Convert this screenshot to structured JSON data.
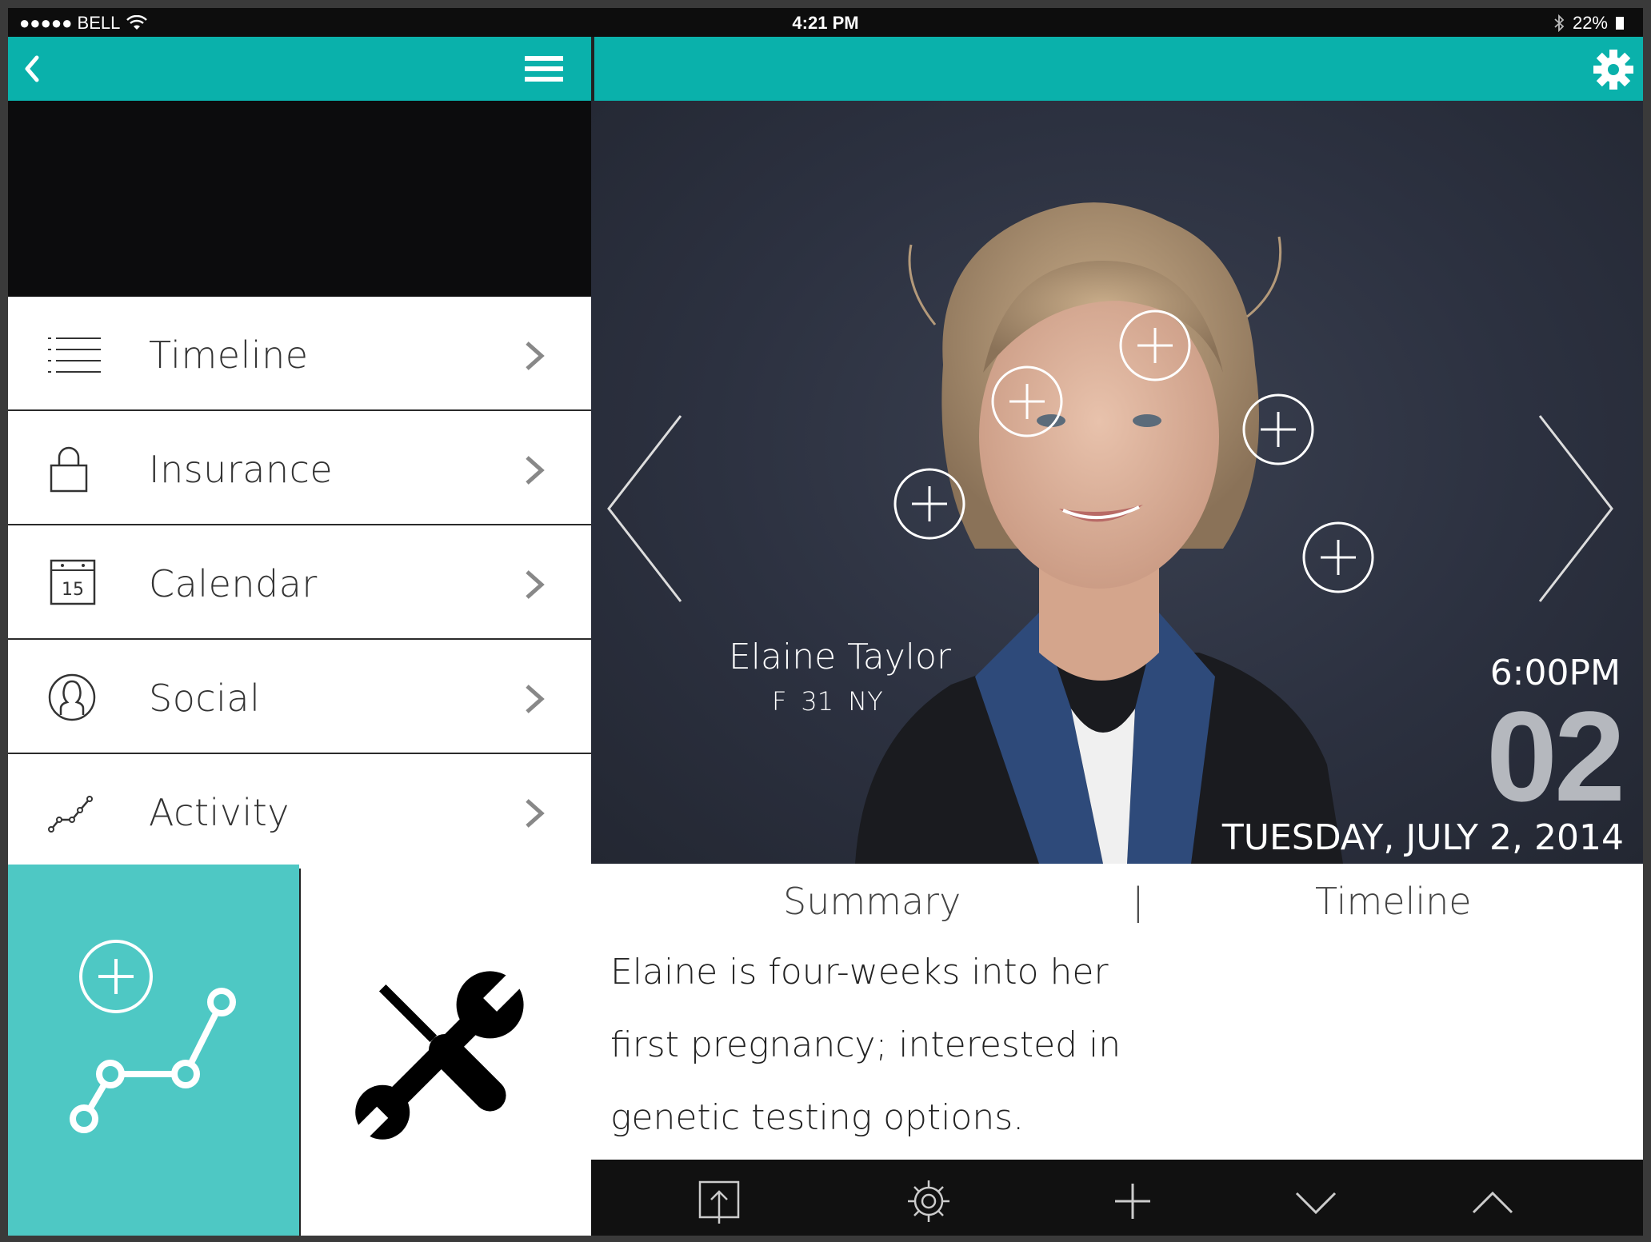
{
  "status_bar": {
    "carrier": "●●●●● BELL",
    "time": "4:21 PM",
    "battery": "22%"
  },
  "menu": {
    "items": [
      {
        "label": "Timeline",
        "icon": "list-icon"
      },
      {
        "label": "Insurance",
        "icon": "lock-icon"
      },
      {
        "label": "Calendar",
        "icon": "calendar-icon",
        "calendar_day": "15"
      },
      {
        "label": "Social",
        "icon": "user-icon"
      },
      {
        "label": "Activity",
        "icon": "activity-graph-icon"
      }
    ]
  },
  "patient": {
    "name": "Elaine Taylor",
    "sex": "F",
    "age": "31",
    "state": "NY"
  },
  "appointment": {
    "time": "6:00PM",
    "day": "02",
    "date": "TUESDAY, JULY 2, 2014"
  },
  "tabs": {
    "summary": "Summary",
    "separator": "|",
    "timeline": "Timeline"
  },
  "summary_text": "Elaine is four-weeks into her first pregnancy; interested in genetic testing options.",
  "colors": {
    "accent": "#0ab1ab",
    "tile": "#4ec8c4",
    "day_number": "#b5b8be"
  }
}
